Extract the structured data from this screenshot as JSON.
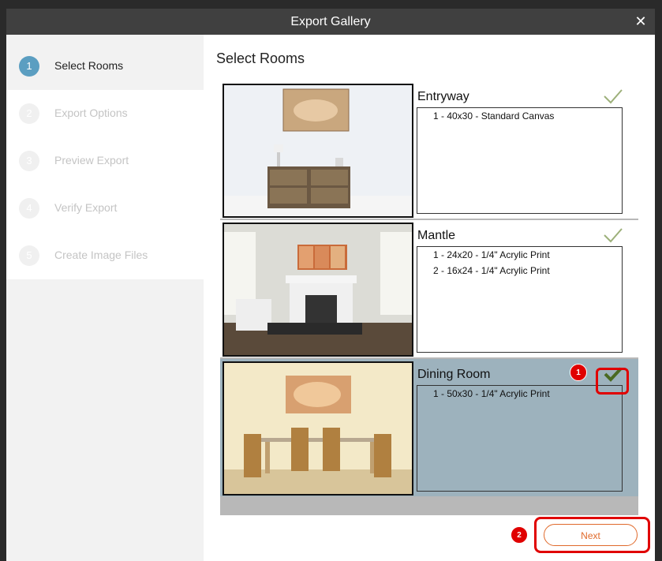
{
  "dialog": {
    "title": "Export Gallery"
  },
  "steps": [
    {
      "number": "1",
      "label": "Select Rooms"
    },
    {
      "number": "2",
      "label": "Export Options"
    },
    {
      "number": "3",
      "label": "Preview Export"
    },
    {
      "number": "4",
      "label": "Verify Export"
    },
    {
      "number": "5",
      "label": "Create Image Files"
    }
  ],
  "main": {
    "heading": "Select Rooms",
    "rooms": [
      {
        "name": "Entryway",
        "products": [
          "1 - 40x30 - Standard Canvas"
        ]
      },
      {
        "name": "Mantle",
        "products": [
          "1 - 24x20 - 1/4\" Acrylic Print",
          "2 - 16x24 - 1/4\" Acrylic Print"
        ]
      },
      {
        "name": "Dining Room",
        "products": [
          "1 - 50x30 - 1/4\" Acrylic Print"
        ]
      }
    ]
  },
  "callouts": {
    "first": "1",
    "second": "2"
  },
  "footer": {
    "next_label": "Next"
  },
  "colors": {
    "accent": "#5b9ec1",
    "next": "#e06a2b",
    "selected_room": "#9db2bd",
    "callout": "#e00000"
  }
}
